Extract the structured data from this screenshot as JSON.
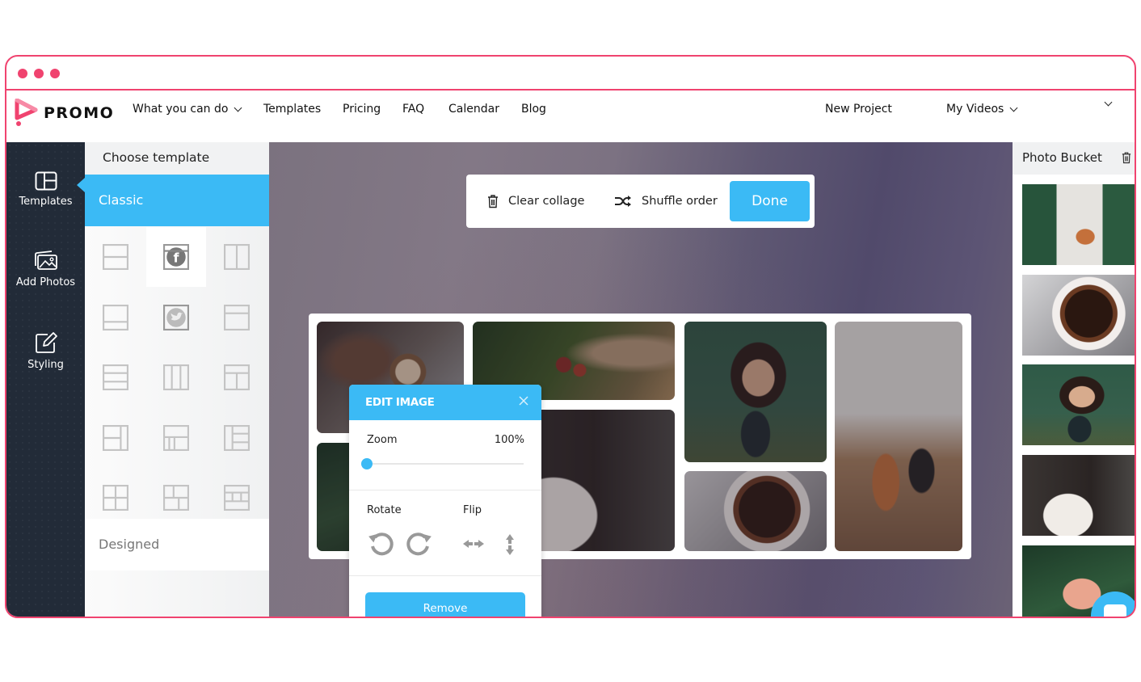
{
  "window": {
    "controls": [
      "dot",
      "dot",
      "dot"
    ],
    "accent_color": "#f0436f"
  },
  "nav": {
    "brand": "PROMO",
    "items": [
      {
        "label": "What you can do",
        "has_dropdown": true
      },
      {
        "label": "Templates"
      },
      {
        "label": "Pricing"
      },
      {
        "label": "FAQ"
      },
      {
        "label": "Calendar"
      },
      {
        "label": "Blog"
      }
    ],
    "right_items": [
      {
        "label": "New Project"
      },
      {
        "label": "My Videos",
        "has_dropdown": true
      }
    ],
    "account_dropdown_icon": "chevron-down-icon"
  },
  "sidebar": {
    "items": [
      {
        "label": "Templates",
        "icon": "layout-icon",
        "active": true
      },
      {
        "label": "Add Photos",
        "icon": "images-icon"
      },
      {
        "label": "Styling",
        "icon": "edit-icon"
      }
    ]
  },
  "template_panel": {
    "title": "Choose template",
    "sections": [
      {
        "label": "Classic",
        "expanded": true
      },
      {
        "label": "Designed",
        "expanded": false
      }
    ],
    "templates": [
      {
        "name": "split-horizontal"
      },
      {
        "name": "facebook",
        "selected": true
      },
      {
        "name": "split-vertical"
      },
      {
        "name": "split-bottom"
      },
      {
        "name": "twitter"
      },
      {
        "name": "split-top"
      },
      {
        "name": "three-rows"
      },
      {
        "name": "three-columns"
      },
      {
        "name": "top-with-two-bottom"
      },
      {
        "name": "two-left-one-right"
      },
      {
        "name": "top-with-three-bottom"
      },
      {
        "name": "one-left-three-right"
      },
      {
        "name": "four-grid"
      },
      {
        "name": "mixed-grid"
      },
      {
        "name": "banded-grid"
      }
    ]
  },
  "toolbar": {
    "clear_label": "Clear collage",
    "shuffle_label": "Shuffle order",
    "done_label": "Done"
  },
  "collage": {
    "photos": [
      {
        "subject": "barista pouring latte"
      },
      {
        "subject": "hand picking coffee cherries"
      },
      {
        "subject": "green plant leaves"
      },
      {
        "subject": "espresso dripping into cup"
      },
      {
        "subject": "smiling woman with coffee cup"
      },
      {
        "subject": "black coffee cup top view"
      },
      {
        "subject": "cafe counter with customers"
      }
    ]
  },
  "edit_image": {
    "title": "EDIT IMAGE",
    "zoom_label": "Zoom",
    "zoom_value": "100%",
    "zoom_slider_fraction": 0.0,
    "rotate_label": "Rotate",
    "flip_label": "Flip",
    "remove_label": "Remove"
  },
  "photo_bucket": {
    "title": "Photo Bucket",
    "photos": [
      {
        "subject": "cafe counter with customers"
      },
      {
        "subject": "black coffee cup top view"
      },
      {
        "subject": "smiling woman with coffee cup"
      },
      {
        "subject": "espresso dripping into cup"
      },
      {
        "subject": "hand holding coffee beans"
      }
    ]
  },
  "colors": {
    "accent_blue": "#3bbaf5",
    "frame_pink": "#f0436f",
    "sidebar_dark": "#222b38"
  }
}
